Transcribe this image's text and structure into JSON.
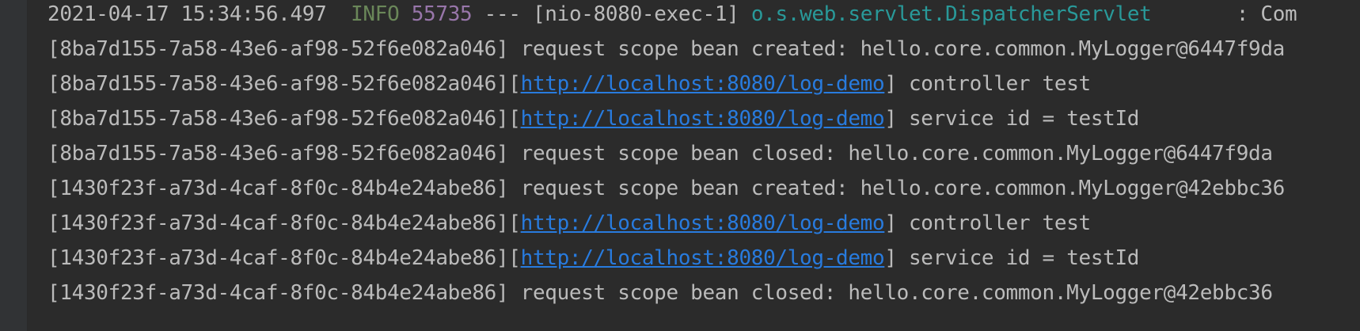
{
  "header": {
    "timestamp": "2021-04-17 15:34:56.497",
    "level": "INFO",
    "pid": "55735",
    "separator": "---",
    "thread": "[nio-8080-exec-1]",
    "logger": "o.s.web.servlet.DispatcherServlet",
    "tail": ": Com"
  },
  "lines": [
    {
      "id": "[8ba7d155-7a58-43e6-af98-52f6e082a046]",
      "text": "request scope bean created: hello.core.common.MyLogger@6447f9da"
    },
    {
      "id": "[8ba7d155-7a58-43e6-af98-52f6e082a046]",
      "open": "[",
      "url": "http://localhost:8080/log-demo",
      "close": "]",
      "text": "controller test"
    },
    {
      "id": "[8ba7d155-7a58-43e6-af98-52f6e082a046]",
      "open": "[",
      "url": "http://localhost:8080/log-demo",
      "close": "]",
      "text": "service id = testId"
    },
    {
      "id": "[8ba7d155-7a58-43e6-af98-52f6e082a046]",
      "text": "request scope bean closed: hello.core.common.MyLogger@6447f9da"
    },
    {
      "id": "[1430f23f-a73d-4caf-8f0c-84b4e24abe86]",
      "text": "request scope bean created: hello.core.common.MyLogger@42ebbc36"
    },
    {
      "id": "[1430f23f-a73d-4caf-8f0c-84b4e24abe86]",
      "open": "[",
      "url": "http://localhost:8080/log-demo",
      "close": "]",
      "text": "controller test"
    },
    {
      "id": "[1430f23f-a73d-4caf-8f0c-84b4e24abe86]",
      "open": "[",
      "url": "http://localhost:8080/log-demo",
      "close": "]",
      "text": "service id = testId"
    },
    {
      "id": "[1430f23f-a73d-4caf-8f0c-84b4e24abe86]",
      "text": "request scope bean closed: hello.core.common.MyLogger@42ebbc36"
    }
  ],
  "colors": {
    "background": "#2b2b2b",
    "text": "#bbbbbb",
    "info": "#6a8759",
    "pid": "#9876aa",
    "logger": "#299999",
    "link": "#287bde"
  }
}
